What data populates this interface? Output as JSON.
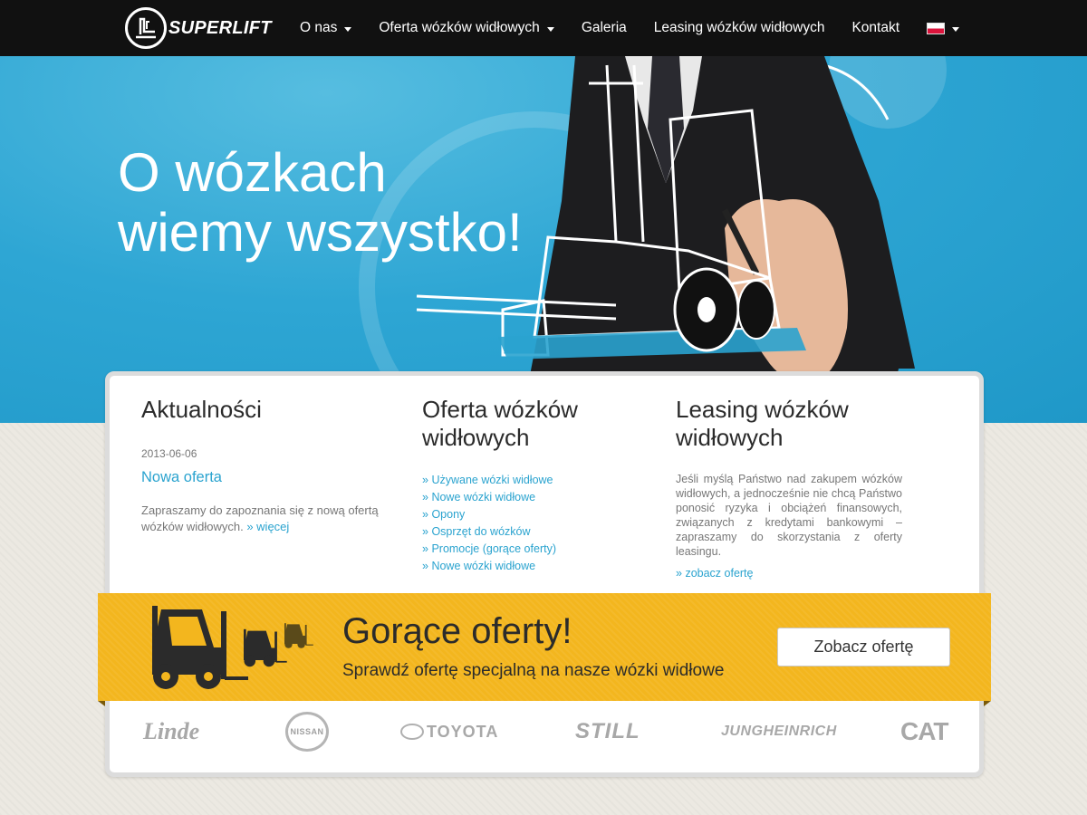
{
  "header": {
    "logo_text": "SUPERLIFT",
    "nav": [
      {
        "label": "O nas",
        "dropdown": true
      },
      {
        "label": "Oferta wózków widłowych",
        "dropdown": true
      },
      {
        "label": "Galeria",
        "dropdown": false
      },
      {
        "label": "Leasing wózków widłowych",
        "dropdown": false
      },
      {
        "label": "Kontakt",
        "dropdown": false
      }
    ],
    "language_flag": "flag-pl-icon"
  },
  "hero": {
    "title_line1": "O wózkach",
    "title_line2": "wiemy wszystko!"
  },
  "news": {
    "heading": "Aktualności",
    "date": "2013-06-06",
    "title": "Nowa oferta",
    "text": "Zapraszamy do zapoznania się z nową ofertą wózków widłowych.",
    "more_link": "» więcej"
  },
  "offer": {
    "heading": "Oferta wózków widłowych",
    "items": [
      "Używane wózki widłowe",
      "Nowe wózki widłowe",
      "Opony",
      "Osprzęt do wózków",
      "Promocje (gorące oferty)",
      "Nowe wózki widłowe"
    ]
  },
  "leasing": {
    "heading": "Leasing wózków widłowych",
    "text": "Jeśli myślą Państwo nad zakupem wózków widłowych, a jednocześnie nie chcą Państwo ponosić ryzyka i obciążeń finansowych, związanych z kredytami bankowymi – zapraszamy do skorzystania z oferty leasingu.",
    "link": "zobacz ofertę"
  },
  "hot_offer": {
    "title": "Gorące oferty!",
    "subtitle": "Sprawdź ofertę specjalną na nasze wózki widłowe",
    "button": "Zobacz ofertę"
  },
  "brands": {
    "linde": "Linde",
    "nissan": "NISSAN",
    "toyota": "TOYOTA",
    "still": "STILL",
    "jungheinrich": "JUNGHEINRICH",
    "cat": "CAT"
  },
  "colors": {
    "nav_bg": "#111111",
    "hero_blue": "#2ea6d4",
    "accent_link": "#2aa3cf",
    "banner_yellow": "#f3b61e"
  }
}
